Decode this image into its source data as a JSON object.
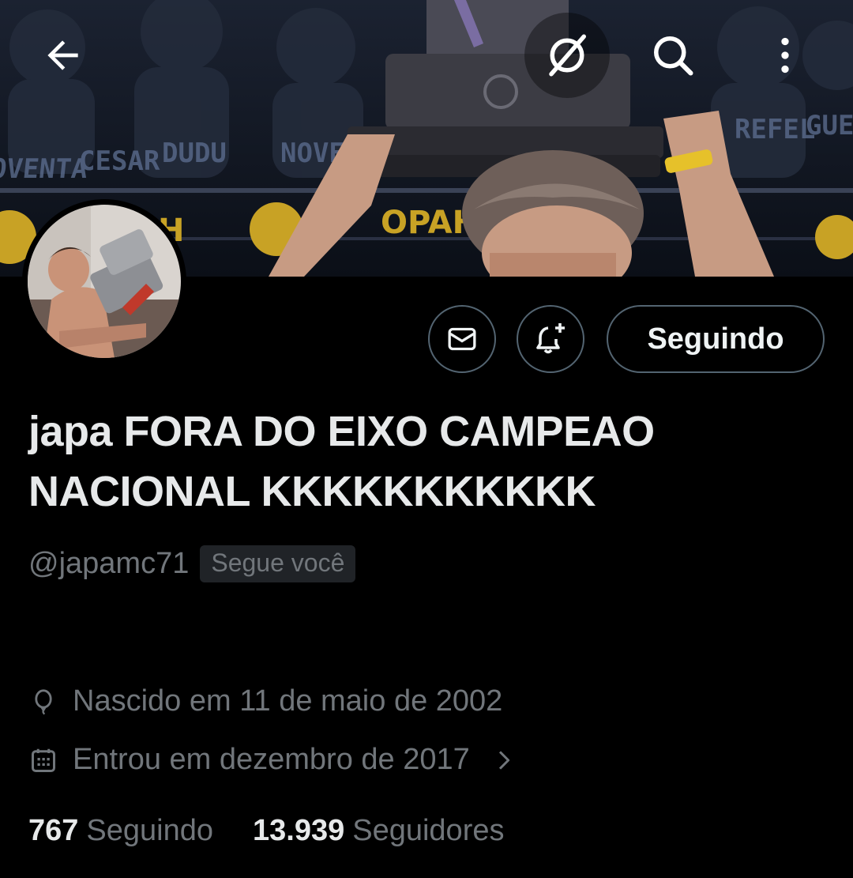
{
  "profile": {
    "display_name": "japa FORA DO EIXO CAMPEAO NACIONAL KKKKKKKKKKK",
    "handle": "@japamc71",
    "follows_you_badge": "Segue você",
    "birth": "Nascido em 11 de maio de 2002",
    "joined": "Entrou em dezembro de 2017"
  },
  "actions": {
    "follow_state_label": "Seguindo"
  },
  "stats": {
    "following_count": "767",
    "following_label": "Seguindo",
    "followers_count": "13.939",
    "followers_label": "Seguidores"
  },
  "icons": {
    "back": "arrow-left-icon",
    "grok": "grok-icon",
    "search": "search-icon",
    "more": "more-vertical-icon",
    "message": "envelope-icon",
    "notify": "bell-plus-icon",
    "birth": "balloon-icon",
    "joined": "calendar-icon",
    "joined_chevron": "chevron-right-icon"
  },
  "banner": {
    "names": [
      "NOVENTA",
      "CESAR",
      "DUDU",
      "NOVENTA",
      "REFEL",
      "GUERR"
    ],
    "brand": "OPAH"
  },
  "colors": {
    "background": "#000000",
    "text_primary": "#e7e9ea",
    "text_secondary": "#71767b",
    "border": "#536471"
  }
}
